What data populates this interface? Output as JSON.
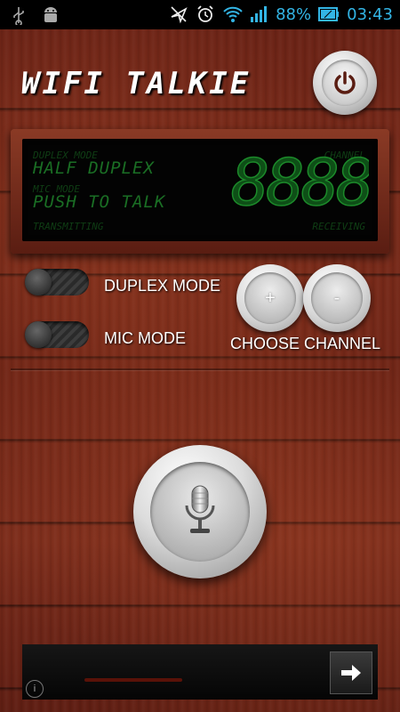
{
  "status_bar": {
    "battery_percent": "88%",
    "time": "03:43",
    "icons": [
      "usb-icon",
      "android-debug-icon",
      "location-off-icon",
      "alarm-icon",
      "wifi-icon",
      "signal-icon",
      "battery-icon"
    ]
  },
  "app": {
    "title": "WIFI TALKIE"
  },
  "display": {
    "duplex_label": "DUPLEX MODE",
    "duplex_value": "HALF DUPLEX",
    "mic_label": "MIC MODE",
    "mic_value": "PUSH TO TALK",
    "transmitting_label": "TRANSMITTING",
    "channel_label": "CHANNEL",
    "channel_digits": "8888",
    "receiving_label": "RECEIVING"
  },
  "controls": {
    "duplex_toggle_label": "DUPLEX MODE",
    "mic_toggle_label": "MIC MODE",
    "channel_plus": "+",
    "channel_minus": "-",
    "choose_channel_label": "CHOOSE CHANNEL"
  },
  "colors": {
    "accent": "#33b5e5",
    "lcd_green": "#1a6e24",
    "wood": "#6b2316"
  }
}
